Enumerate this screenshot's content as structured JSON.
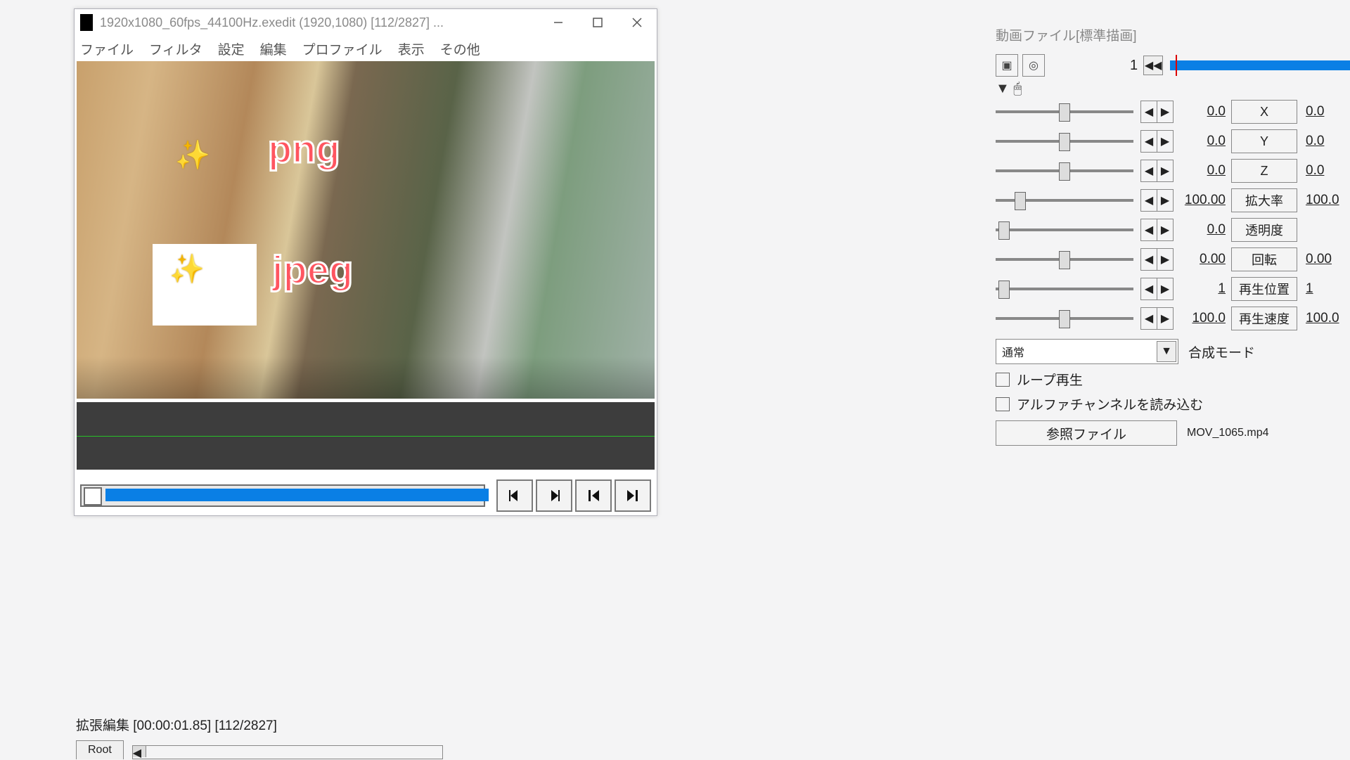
{
  "main_window": {
    "title": "1920x1080_60fps_44100Hz.exedit (1920,1080)  [112/2827]  ..."
  },
  "menus": [
    "ファイル",
    "フィルタ",
    "設定",
    "編集",
    "プロファイル",
    "表示",
    "その他"
  ],
  "preview": {
    "png_label": "png",
    "jpeg_label": "jpeg"
  },
  "playbar_icons": [
    "◀|",
    "|▶",
    "|◀",
    "▶|"
  ],
  "side": {
    "title": "動画ファイル[標準描画]",
    "frame": "1",
    "mouse_marker": "▼  🖱",
    "params": [
      {
        "val": "0.0",
        "btn": "X",
        "val2": "0.0",
        "knob": 0.5
      },
      {
        "val": "0.0",
        "btn": "Y",
        "val2": "0.0",
        "knob": 0.5
      },
      {
        "val": "0.0",
        "btn": "Z",
        "val2": "0.0",
        "knob": 0.5
      },
      {
        "val": "100.00",
        "btn": "拡大率",
        "val2": "100.0",
        "knob": 0.15
      },
      {
        "val": "0.0",
        "btn": "透明度",
        "val2": "",
        "knob": 0.02
      },
      {
        "val": "0.00",
        "btn": "回転",
        "val2": "0.00",
        "knob": 0.5
      },
      {
        "val": "1",
        "btn": "再生位置",
        "val2": "1",
        "knob": 0.02
      },
      {
        "val": "100.0",
        "btn": "再生速度",
        "val2": "100.0",
        "knob": 0.5
      }
    ],
    "combo_value": "通常",
    "combo_label": "合成モード",
    "checks": [
      "ループ再生",
      "アルファチャンネルを読み込む"
    ],
    "ref_btn": "参照ファイル",
    "ref_file": "MOV_1065.mp4"
  },
  "timeline": {
    "title": "拡張編集 [00:00:01.85] [112/2827]",
    "tab": "Root"
  }
}
